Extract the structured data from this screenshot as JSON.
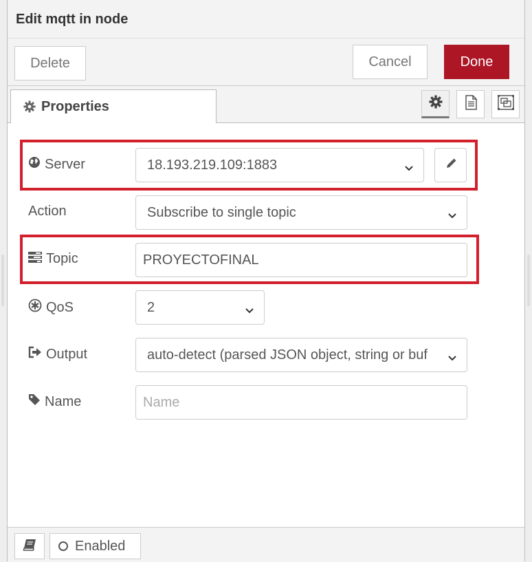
{
  "header": {
    "title": "Edit mqtt in node"
  },
  "toolbar": {
    "delete_label": "Delete",
    "cancel_label": "Cancel",
    "done_label": "Done"
  },
  "tabs": {
    "properties_label": "Properties",
    "side_tabs": [
      "gear-icon",
      "description-icon",
      "appearance-icon"
    ]
  },
  "form": {
    "server": {
      "label": "Server",
      "value": "18.193.219.109:1883",
      "icon": "globe-icon"
    },
    "action": {
      "label": "Action",
      "value": "Subscribe to single topic"
    },
    "topic": {
      "label": "Topic",
      "value": "PROYECTOFINAL",
      "icon": "tasks-icon"
    },
    "qos": {
      "label": "QoS",
      "value": "2",
      "icon": "asterisk-icon"
    },
    "output": {
      "label": "Output",
      "value": "auto-detect (parsed JSON object, string or buf",
      "icon": "sign-out-icon"
    },
    "name": {
      "label": "Name",
      "placeholder": "Name",
      "icon": "tag-icon"
    }
  },
  "footer": {
    "enabled_label": "Enabled"
  },
  "colors": {
    "accent": "#ad1625",
    "highlight": "#d21f2c"
  }
}
